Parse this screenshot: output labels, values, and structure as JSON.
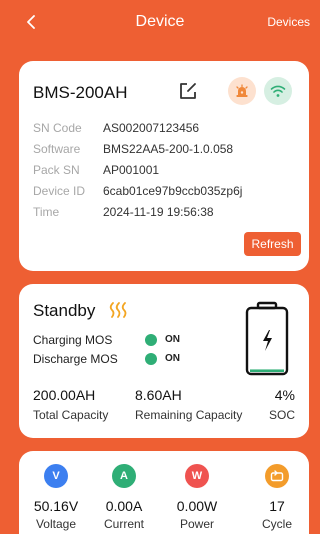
{
  "header": {
    "back_icon": "chevron-left-icon",
    "title": "Device",
    "devices_link": "Devices"
  },
  "device_card": {
    "name": "BMS-200AH",
    "icons": {
      "edit": "edit-icon",
      "alarm": "alarm-icon",
      "wifi": "wifi-icon"
    },
    "info": [
      {
        "label": "SN Code",
        "value": "AS002007123456"
      },
      {
        "label": "Software",
        "value": "BMS22AA5-200-1.0.058"
      },
      {
        "label": "Pack SN",
        "value": "AP001001"
      },
      {
        "label": "Device ID",
        "value": "6cab01ce97b9ccb035zp6j"
      },
      {
        "label": "Time",
        "value": "2024-11-19 19:56:38"
      }
    ],
    "refresh_label": "Refresh"
  },
  "status_card": {
    "status": "Standby",
    "mos": [
      {
        "label": "Charging MOS",
        "state": "ON"
      },
      {
        "label": "Discharge MOS",
        "state": "ON"
      }
    ],
    "metrics": [
      {
        "value": "200.00AH",
        "label": "Total Capacity"
      },
      {
        "value": "8.60AH",
        "label": "Remaining Capacity"
      },
      {
        "value": "4%",
        "label": "SOC"
      }
    ],
    "soc_fraction": 0.04
  },
  "stats_card": {
    "items": [
      {
        "icon": "voltage-icon",
        "letter": "V",
        "value": "50.16V",
        "label": "Voltage",
        "color": "#3c7ff0"
      },
      {
        "icon": "current-icon",
        "letter": "A",
        "value": "0.00A",
        "label": "Current",
        "color": "#2fae76"
      },
      {
        "icon": "power-icon",
        "letter": "W",
        "value": "0.00W",
        "label": "Power",
        "color": "#ef5350"
      },
      {
        "icon": "cycle-icon",
        "letter": "",
        "value": "17",
        "label": "Cycle",
        "color": "#f39c2b"
      }
    ]
  },
  "colors": {
    "brand": "#ee5f33",
    "on": "#2fae76"
  }
}
